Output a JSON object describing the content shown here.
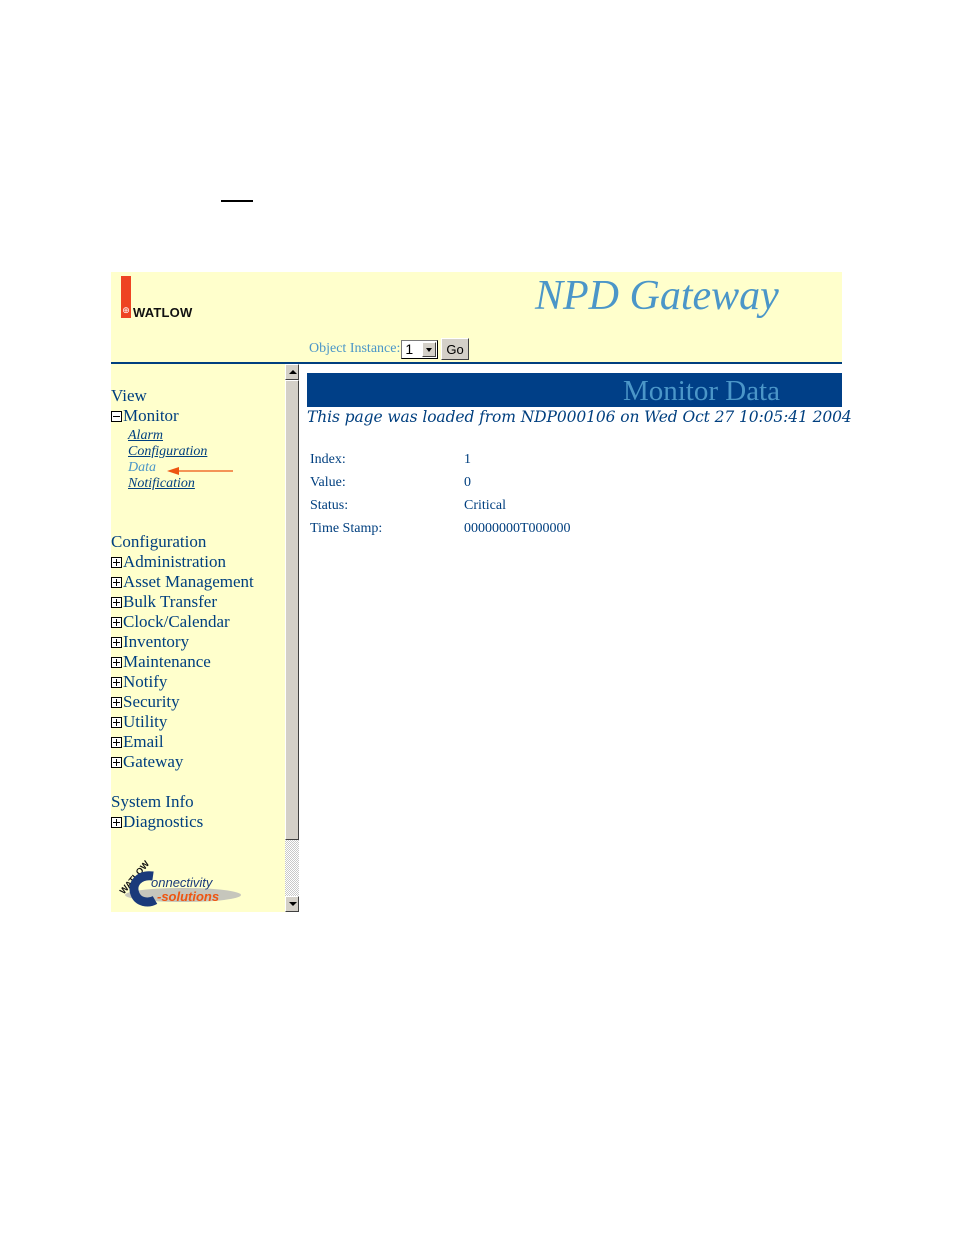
{
  "header": {
    "brand": "WATLOW",
    "app_title": "NPD Gateway",
    "object_instance_label": "Object Instance:",
    "object_instance_value": "1",
    "go_label": "Go"
  },
  "sidebar": {
    "view_heading": "View",
    "monitor_label": "Monitor",
    "monitor_items": [
      {
        "label": "Alarm",
        "active": false
      },
      {
        "label": "Configuration",
        "active": false
      },
      {
        "label": "Data",
        "active": true
      },
      {
        "label": "Notification",
        "active": false
      }
    ],
    "configuration_heading": "Configuration",
    "configuration_items": [
      {
        "label": "Administration"
      },
      {
        "label": "Asset Management"
      },
      {
        "label": "Bulk Transfer"
      },
      {
        "label": "Clock/Calendar"
      },
      {
        "label": "Inventory"
      },
      {
        "label": "Maintenance"
      },
      {
        "label": "Notify"
      },
      {
        "label": "Security"
      },
      {
        "label": "Utility"
      },
      {
        "label": "Email"
      },
      {
        "label": "Gateway"
      }
    ],
    "system_info_heading": "System Info",
    "system_info_items": [
      {
        "label": "Diagnostics"
      }
    ],
    "bottom_logo": {
      "top_text": "WATLOW",
      "line1": "onnectivity",
      "line2": "-solutions"
    }
  },
  "main": {
    "banner_title": "Monitor Data",
    "load_message": "This page was loaded from NDP000106 on Wed Oct 27 10:05:41 2004",
    "fields": [
      {
        "label": "Index:",
        "value": "1"
      },
      {
        "label": "Value:",
        "value": "0"
      },
      {
        "label": "Status:",
        "value": "Critical"
      },
      {
        "label": "Time Stamp:",
        "value": "00000000T000000"
      }
    ]
  },
  "colors": {
    "panel_bg": "#ffffcc",
    "navy": "#003f7f",
    "banner": "#003f87",
    "light_blue": "#4b96c8",
    "accent_red": "#ee4422"
  }
}
